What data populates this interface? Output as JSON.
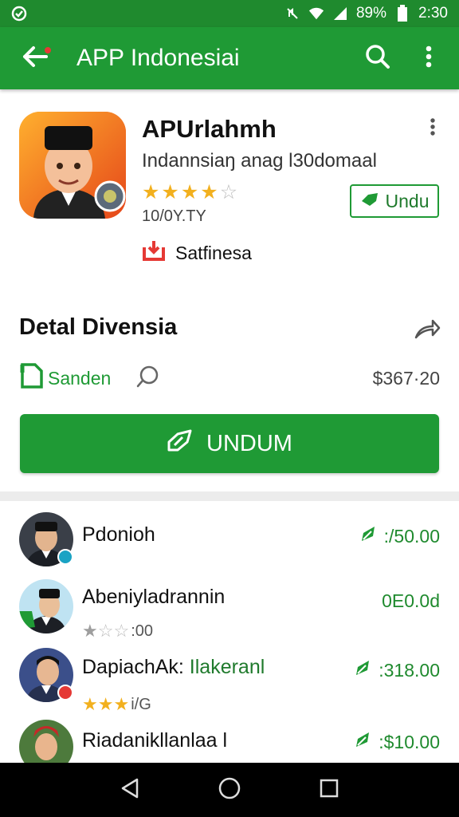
{
  "status_bar": {
    "battery": "89%",
    "time": "2:30"
  },
  "app_bar": {
    "title": "APP Indonesiai"
  },
  "app": {
    "name": "APUrlahmh",
    "subtitle": "Indannsiaŋ anag l30domaal",
    "rating": 4,
    "downloads": "10/0Y.TY",
    "install_label": "Undu",
    "tag_label": "Satfinesa"
  },
  "details": {
    "title": "Detal Divensia",
    "sanden_label": "Sanden",
    "price": "$367·20",
    "main_button_label": "UNDUM"
  },
  "list": [
    {
      "name": "Pdonioh",
      "name_accent": "",
      "price": ":/50.00",
      "rating_text": "",
      "rating": null,
      "price_icon": true
    },
    {
      "name": "Abeniyladrannin",
      "name_accent": "",
      "price": "0E0.0d",
      "rating_text": ":00",
      "rating": 1,
      "price_icon": false
    },
    {
      "name": "DapiachAk: ",
      "name_accent": "Ilakeranl",
      "price": ":318.00",
      "rating_text": "i/G",
      "rating": 3,
      "price_icon": true
    },
    {
      "name": "Riadanikllanlaa l",
      "name_accent": "",
      "price": ":$10.00",
      "rating_text": "",
      "rating": null,
      "price_icon": true
    }
  ],
  "colors": {
    "primary": "#1f9a35",
    "status_bar": "#1f8a2e",
    "star": "#f2b01e"
  },
  "icons": [
    "back-arrow-icon",
    "search-icon",
    "more-vert-icon",
    "share-icon",
    "chat-icon",
    "download-icon",
    "nav-back-icon",
    "nav-home-icon",
    "nav-recents-icon"
  ]
}
